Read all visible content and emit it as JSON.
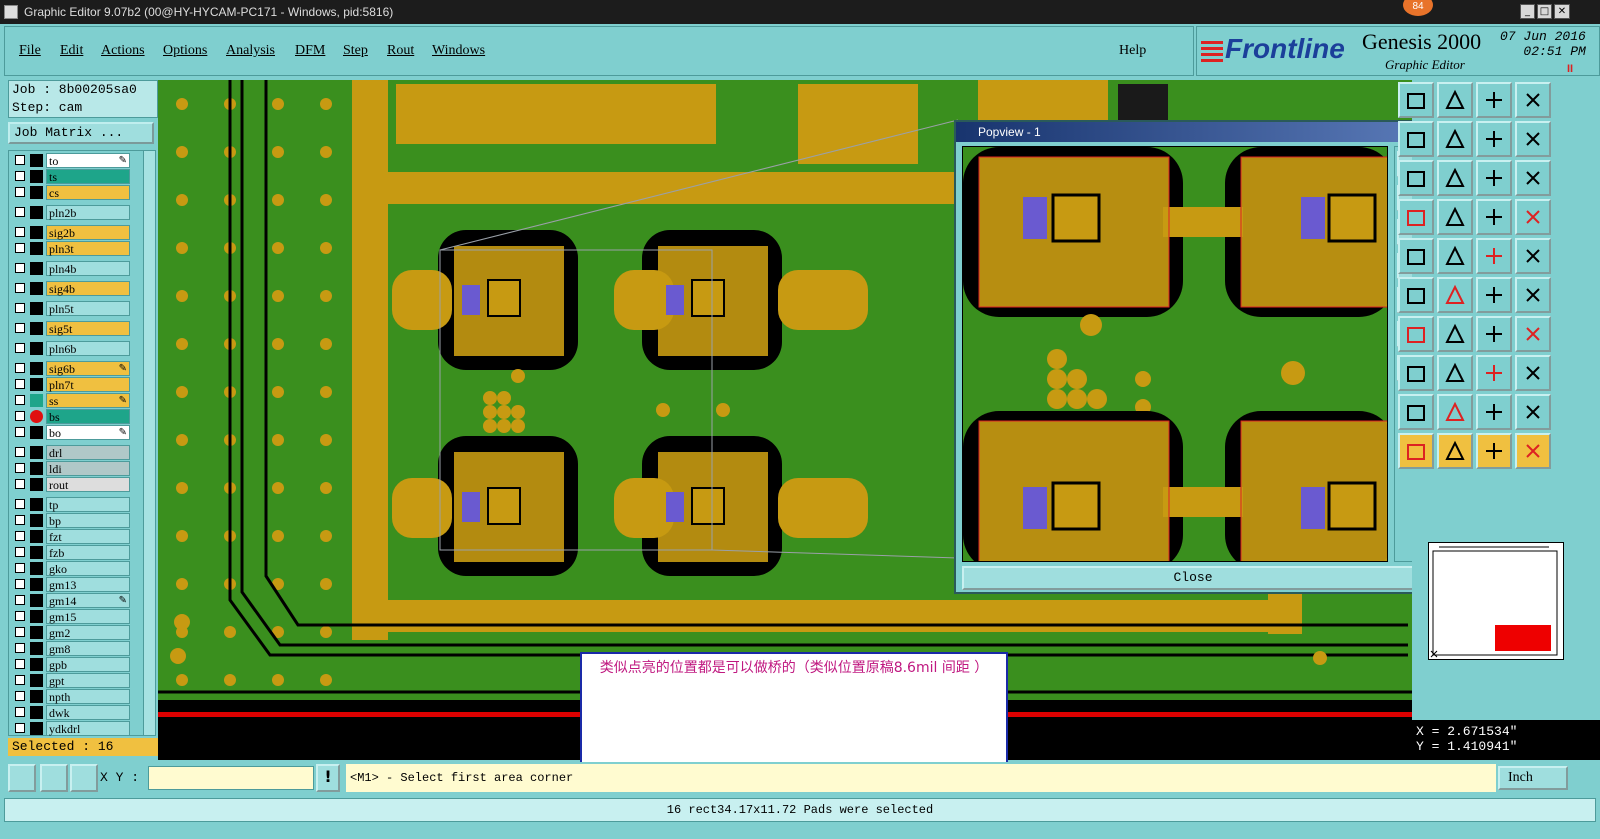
{
  "window": {
    "title": "Graphic Editor 9.07b2 (00@HY-HYCAM-PC171 - Windows, pid:5816)",
    "badge": "84",
    "minimize": "_",
    "maximize": "□",
    "close": "✕"
  },
  "menu": {
    "items": [
      "File",
      "Edit",
      "Actions",
      "Options",
      "Analysis",
      "DFM",
      "Step",
      "Rout",
      "Windows"
    ],
    "help": "Help"
  },
  "brand": {
    "logo": "Frontline",
    "product": "Genesis 2000",
    "subtitle": "Graphic Editor",
    "date": "07 Jun 2016",
    "time": "02:51 PM",
    "pause": "II"
  },
  "job": {
    "job_line": "Job : 8b00205sa0",
    "step_line": "Step: cam",
    "matrix_button": "Job Matrix ..."
  },
  "layers": [
    {
      "name": "to",
      "bg": "#ffffff",
      "edit": true
    },
    {
      "name": "ts",
      "bg": "#1ea58a",
      "edit": false
    },
    {
      "name": "cs",
      "bg": "#f0c040",
      "edit": false
    },
    {
      "name": "pln2b",
      "bg": "#9fdede",
      "edit": false
    },
    {
      "name": "sig2b",
      "bg": "#f0c040",
      "edit": false
    },
    {
      "name": "pln3t",
      "bg": "#f0c040",
      "edit": false
    },
    {
      "name": "pln4b",
      "bg": "#9fdede",
      "edit": false
    },
    {
      "name": "sig4b",
      "bg": "#f0c040",
      "edit": false
    },
    {
      "name": "pln5t",
      "bg": "#9fdede",
      "edit": false
    },
    {
      "name": "sig5t",
      "bg": "#f0c040",
      "edit": false
    },
    {
      "name": "pln6b",
      "bg": "#9fdede",
      "edit": false
    },
    {
      "name": "sig6b",
      "bg": "#f0c040",
      "edit": true
    },
    {
      "name": "pln7t",
      "bg": "#f0c040",
      "edit": false
    },
    {
      "name": "ss",
      "bg": "#f0c040",
      "edit": true
    },
    {
      "name": "bs",
      "bg": "#1ea58a",
      "edit": false
    },
    {
      "name": "bo",
      "bg": "#ffffff",
      "edit": true
    },
    {
      "name": "drl",
      "bg": "#b0c8c8",
      "edit": false
    },
    {
      "name": "ldi",
      "bg": "#b0c8c8",
      "edit": false
    },
    {
      "name": "rout",
      "bg": "#dddddd",
      "edit": false
    },
    {
      "name": "tp",
      "bg": "#9fdede",
      "edit": false
    },
    {
      "name": "bp",
      "bg": "#9fdede",
      "edit": false
    },
    {
      "name": "fzt",
      "bg": "#9fdede",
      "edit": false
    },
    {
      "name": "fzb",
      "bg": "#9fdede",
      "edit": false
    },
    {
      "name": "gko",
      "bg": "#9fdede",
      "edit": false
    },
    {
      "name": "gm13",
      "bg": "#9fdede",
      "edit": false
    },
    {
      "name": "gm14",
      "bg": "#9fdede",
      "edit": true
    },
    {
      "name": "gm15",
      "bg": "#9fdede",
      "edit": false
    },
    {
      "name": "gm2",
      "bg": "#9fdede",
      "edit": false
    },
    {
      "name": "gm8",
      "bg": "#9fdede",
      "edit": false
    },
    {
      "name": "gpb",
      "bg": "#9fdede",
      "edit": false
    },
    {
      "name": "gpt",
      "bg": "#9fdede",
      "edit": false
    },
    {
      "name": "npth",
      "bg": "#9fdede",
      "edit": false
    },
    {
      "name": "dwk",
      "bg": "#9fdede",
      "edit": false
    },
    {
      "name": "ydkdrl",
      "bg": "#9fdede",
      "edit": false
    }
  ],
  "selected": "Selected : 16",
  "popview": {
    "title": "Popview - 1",
    "close_label": "Close",
    "close_x": "✕"
  },
  "note": {
    "text": "类似点亮的位置都是可以做桥的（类似位置原稿8.6mil 间距  ）"
  },
  "coords": {
    "x": "X = 2.671534\"",
    "y": "Y = 1.410941\""
  },
  "command": {
    "xy_label": "X Y :",
    "xy_value": "",
    "prompt": "<M1> - Select first area corner",
    "unit": "Inch"
  },
  "status": "16 rect34.17x11.72 Pads were selected",
  "colors": {
    "board_green": "#3a8f1e",
    "copper": "#c79a12",
    "background": "#7fcfcf",
    "note_text": "#c01880"
  }
}
